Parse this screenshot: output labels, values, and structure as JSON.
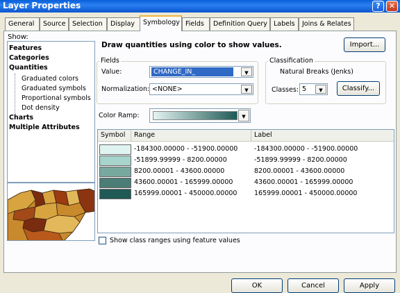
{
  "window": {
    "title": "Layer Properties",
    "help_glyph": "?",
    "close_glyph": "✕"
  },
  "tabs": [
    "General",
    "Source",
    "Selection",
    "Display",
    "Symbology",
    "Fields",
    "Definition Query",
    "Labels",
    "Joins & Relates"
  ],
  "active_tab": "Symbology",
  "show": {
    "label": "Show:",
    "items": [
      {
        "label": "Features",
        "bold": true
      },
      {
        "label": "Categories",
        "bold": true
      },
      {
        "label": "Quantities",
        "bold": true
      },
      {
        "label": "Graduated colors",
        "bold": false,
        "selected": true
      },
      {
        "label": "Graduated symbols",
        "bold": false
      },
      {
        "label": "Proportional symbols",
        "bold": false
      },
      {
        "label": "Dot density",
        "bold": false
      },
      {
        "label": "Charts",
        "bold": true
      },
      {
        "label": "Multiple Attributes",
        "bold": true
      }
    ]
  },
  "header_text": "Draw quantities using color to show values.",
  "import_label": "Import...",
  "fields": {
    "group_label": "Fields",
    "value_label": "Value:",
    "value": "CHANGE_IN_",
    "normalization_label": "Normalization:",
    "normalization": "<NONE>"
  },
  "classification": {
    "group_label": "Classification",
    "method": "Natural Breaks (Jenks)",
    "classes_label": "Classes:",
    "classes": "5",
    "classify_label": "Classify..."
  },
  "color_ramp": {
    "label": "Color Ramp:",
    "start_color": "#e4f4f1",
    "end_color": "#1f5a56"
  },
  "table": {
    "headers": [
      "Symbol",
      "Range",
      "Label"
    ],
    "rows": [
      {
        "color": "#dff3f0",
        "range": "-184300.00000 - -51900.00000",
        "label": "-184300.00000 - -51900.00000"
      },
      {
        "color": "#a7d4cd",
        "range": "-51899.99999 - 8200.00000",
        "label": "-51899.99999 - 8200.00000"
      },
      {
        "color": "#79a89f",
        "range": "8200.00001 - 43600.00000",
        "label": "8200.00001 - 43600.00000"
      },
      {
        "color": "#4b7d76",
        "range": "43600.00001 - 165999.00000",
        "label": "43600.00001 - 165999.00000"
      },
      {
        "color": "#1f5a56",
        "range": "165999.00001 - 450000.00000",
        "label": "165999.00001 - 450000.00000"
      }
    ]
  },
  "show_class_ranges_label": "Show class ranges using feature values",
  "footer": {
    "ok": "OK",
    "cancel": "Cancel",
    "apply": "Apply"
  }
}
